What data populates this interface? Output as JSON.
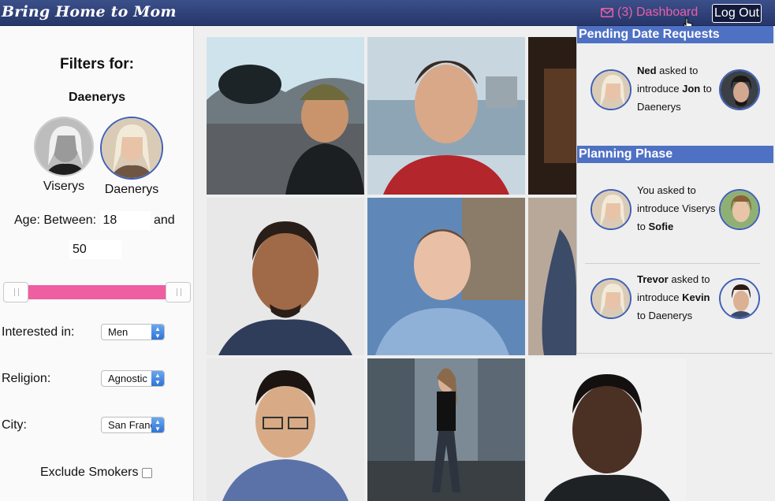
{
  "header": {
    "brand": "Bring Home to Mom",
    "dashboard_label": "(3) Dashboard",
    "logout_label": "Log Out"
  },
  "colors": {
    "header": "#2c3d75",
    "accent": "#ea5fa6",
    "panel_head": "#4f71c4",
    "slider": "#ef5ea0"
  },
  "sidebar": {
    "title": "Filters for:",
    "current_name": "Daenerys",
    "people": [
      {
        "name": "Viserys",
        "selected": false
      },
      {
        "name": "Daenerys",
        "selected": true
      }
    ],
    "age_label": "Age: Between:",
    "age_min": "18",
    "age_and": "and",
    "age_max": "50",
    "interested_label": "Interested in:",
    "interested_value": "Men",
    "religion_label": "Religion:",
    "religion_value": "Agnostic",
    "city_label": "City:",
    "city_value": "San Francisco",
    "smokers_label": "Exclude Smokers"
  },
  "panel": {
    "pending_title": "Pending Date Requests",
    "planning_title": "Planning Phase",
    "requests": [
      {
        "pre": "",
        "who": "Ned",
        "mid": " asked to introduce ",
        "target": "Jon",
        "post": " to Daenerys"
      },
      {
        "pre": "You asked to introduce Viserys to ",
        "who": "",
        "mid": "",
        "target": "Sofie",
        "post": ""
      },
      {
        "pre": "",
        "who": "Trevor",
        "mid": " asked to introduce ",
        "target": "Kevin",
        "post": " to Daenerys"
      }
    ]
  }
}
